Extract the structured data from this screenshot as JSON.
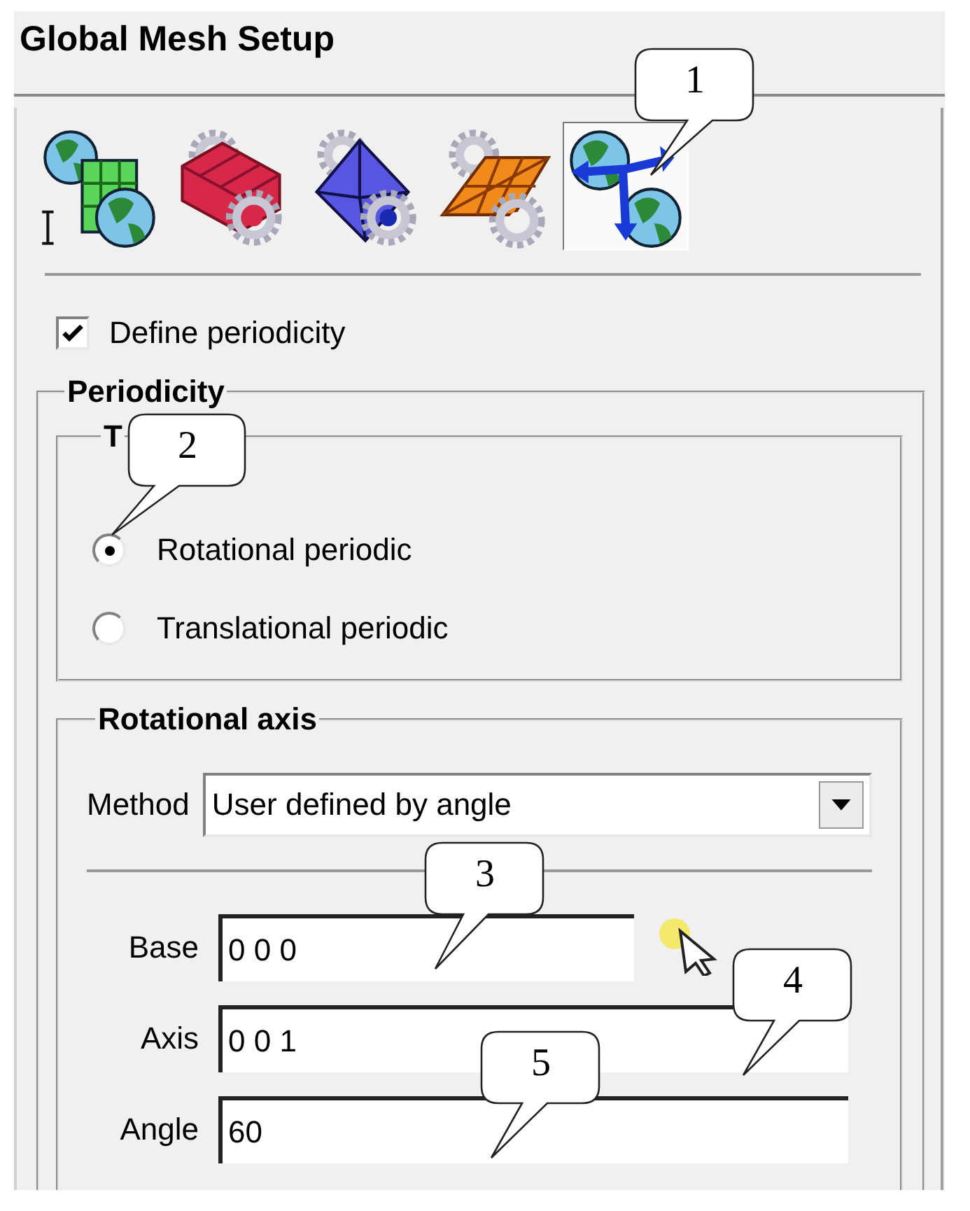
{
  "window": {
    "title": "Global Mesh Setup"
  },
  "toolbar": [
    {
      "kind": "global",
      "selected": false
    },
    {
      "kind": "hexa",
      "selected": false
    },
    {
      "kind": "prism",
      "selected": false
    },
    {
      "kind": "shell",
      "selected": false
    },
    {
      "kind": "periodic",
      "selected": true
    }
  ],
  "define_periodicity": {
    "label": "Define periodicity",
    "checked": true
  },
  "periodicity": {
    "title": "Periodicity",
    "type": {
      "title": "T",
      "options": [
        {
          "label": "Rotational periodic",
          "selected": true
        },
        {
          "label": "Translational periodic",
          "selected": false
        }
      ]
    },
    "rotational_axis": {
      "title": "Rotational axis",
      "method": {
        "label": "Method",
        "value": "User defined by angle"
      },
      "fields": [
        {
          "label": "Base",
          "value": "0 0 0"
        },
        {
          "label": "Axis",
          "value": "0 0 1"
        },
        {
          "label": "Angle",
          "value": "60"
        }
      ]
    }
  },
  "callouts": [
    "1",
    "2",
    "3",
    "4",
    "5"
  ]
}
